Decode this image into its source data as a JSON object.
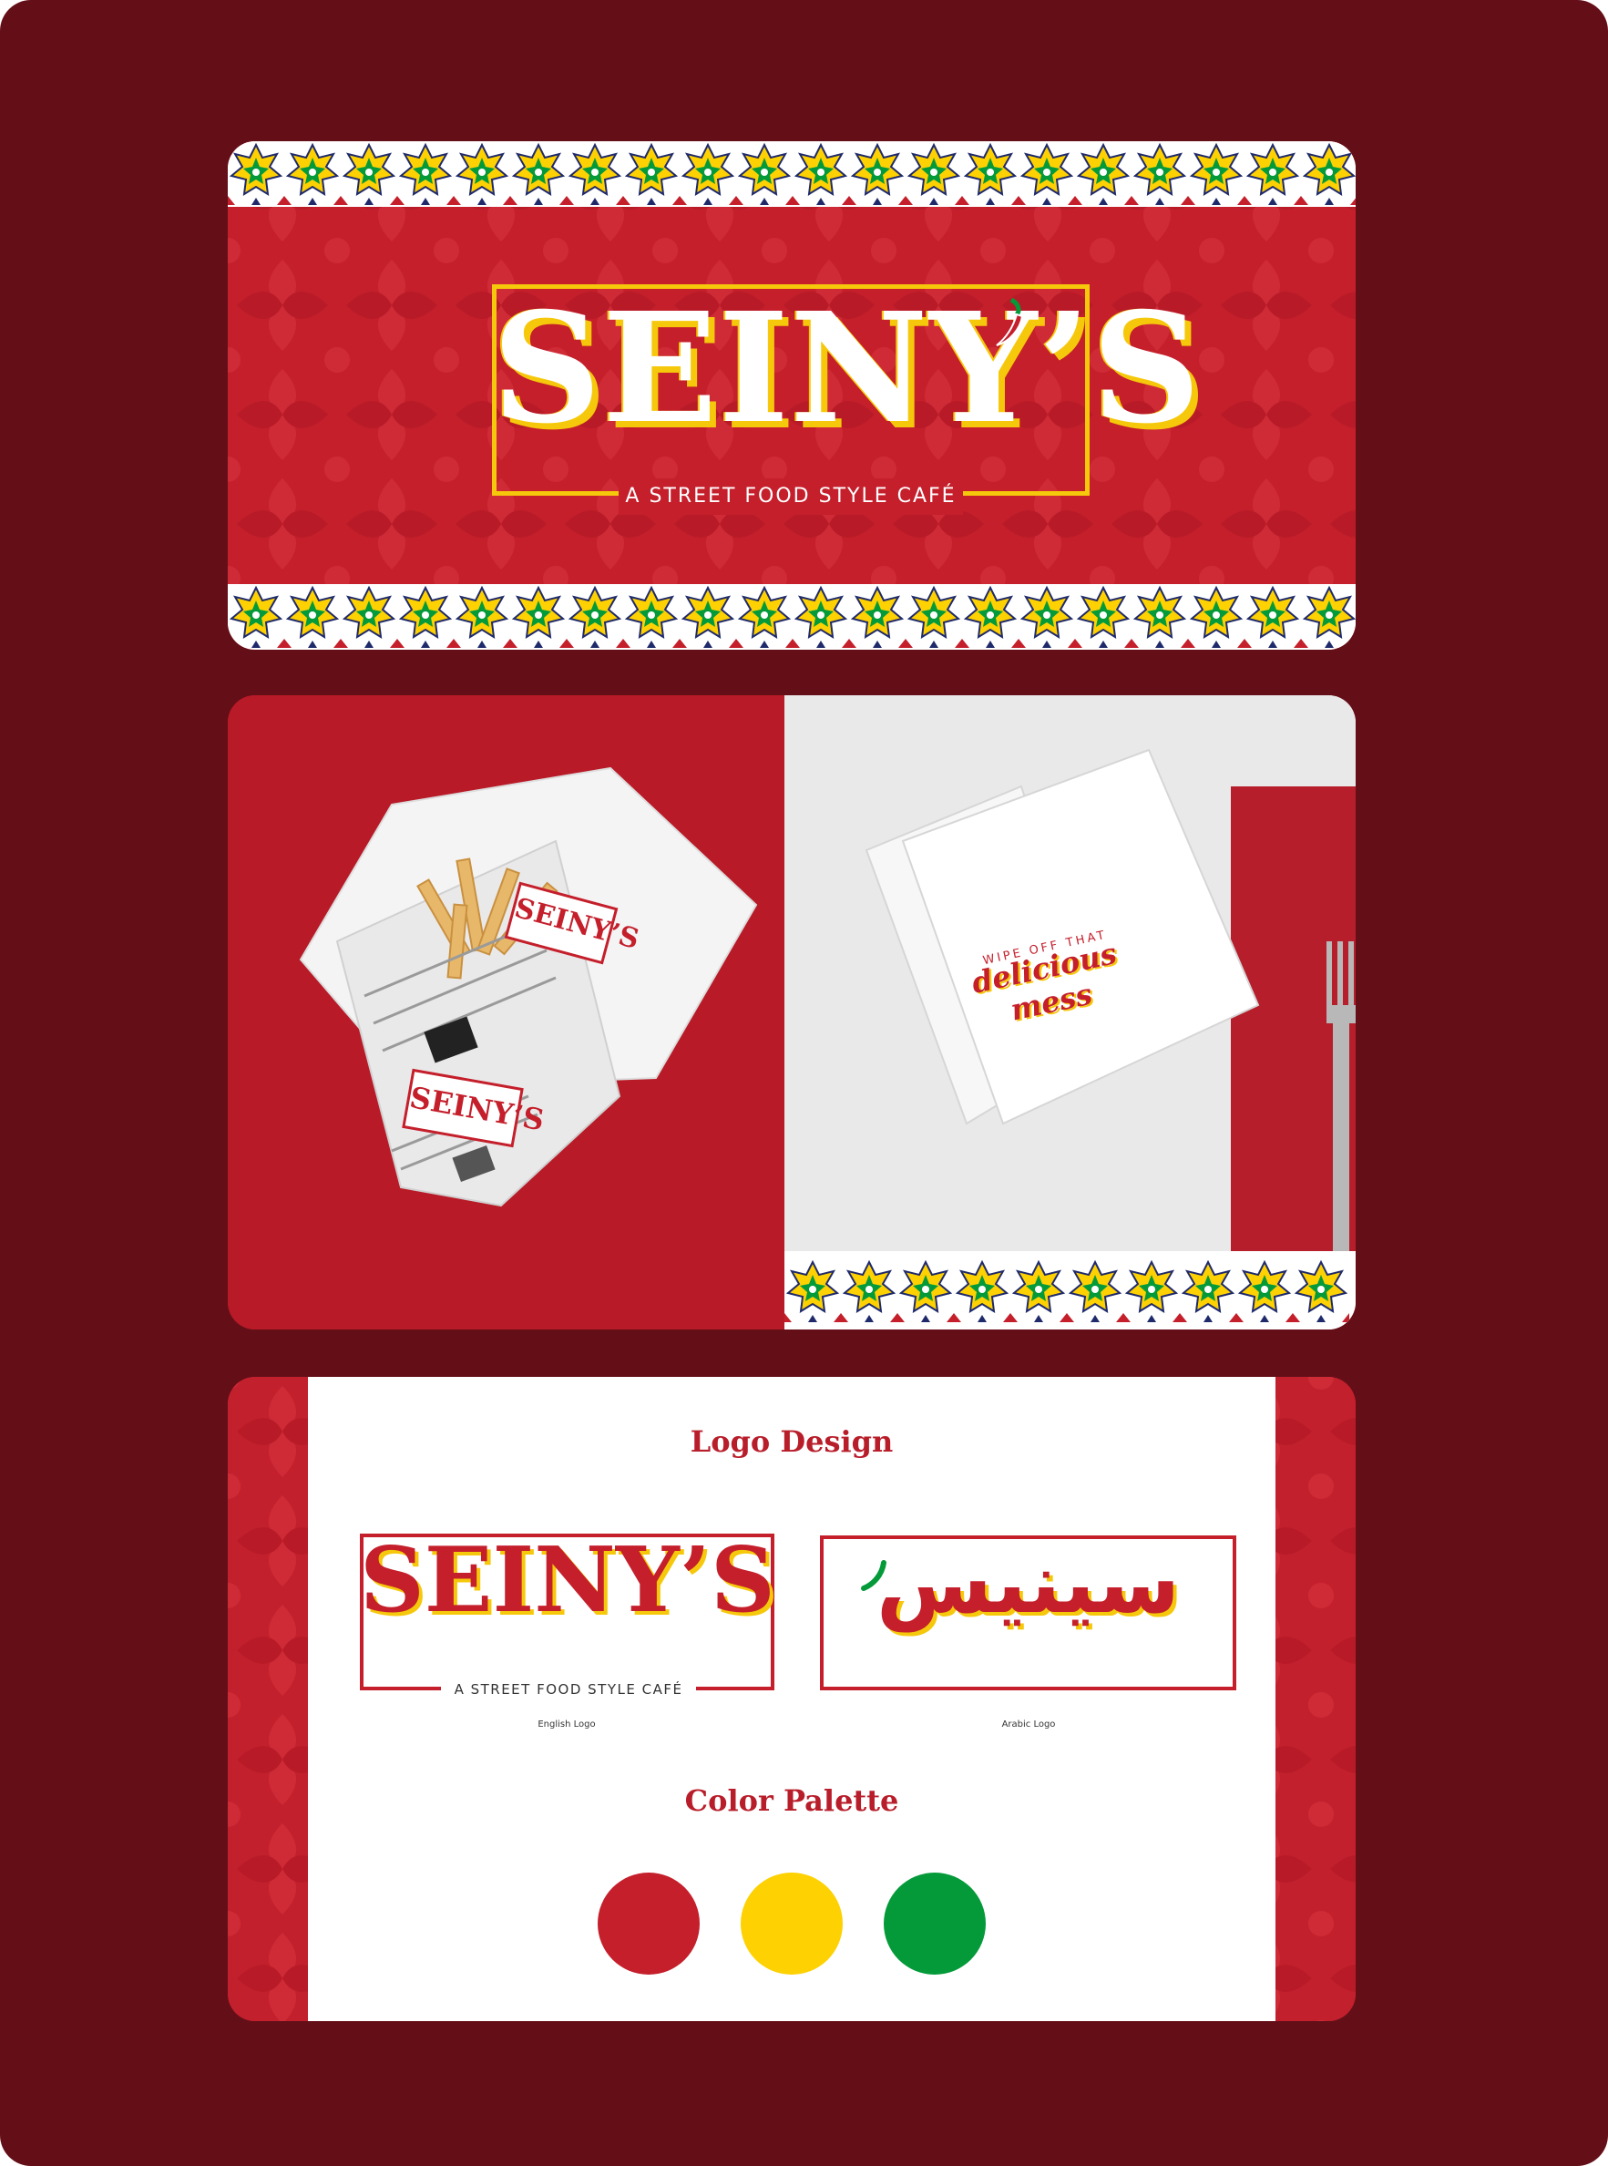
{
  "hero": {
    "wordmark": "SEINY’S",
    "tagline": "A STREET FOOD STYLE CAFÉ"
  },
  "mockups": {
    "fries_stamp_top": "SEINY’S",
    "fries_stamp_bottom": "SEINY’S",
    "napkin_line1": "WIPE OFF THAT",
    "napkin_line2": "delicious mess"
  },
  "logo_design": {
    "title": "Logo Design",
    "english_wordmark": "SEINY’S",
    "english_tagline": "A STREET FOOD STYLE CAFÉ",
    "english_caption": "English Logo",
    "arabic_wordmark": "سينيس",
    "arabic_caption": "Arabic Logo"
  },
  "palette": {
    "title": "Color Palette",
    "colors": [
      "#c41f2b",
      "#fdd102",
      "#049a3a"
    ]
  },
  "colors": {
    "page_background": "#640f18",
    "brand_red": "#c41f2b",
    "accent_yellow": "#f6c80b",
    "accent_green": "#049a3a",
    "accent_navy": "#1f2a6b"
  }
}
